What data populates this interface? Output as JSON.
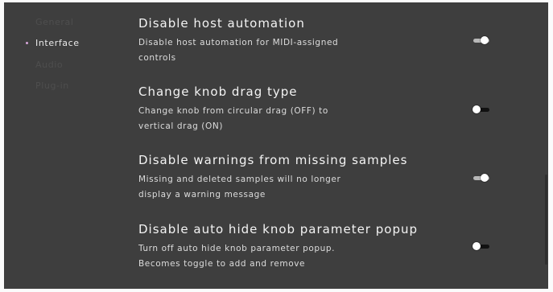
{
  "sidebar": {
    "items": [
      {
        "label": "General",
        "active": false
      },
      {
        "label": "Interface",
        "active": true
      },
      {
        "label": "Audio",
        "active": false
      },
      {
        "label": "Plug-in",
        "active": false
      }
    ]
  },
  "settings": [
    {
      "title": "Disable host automation",
      "description_line1": "Disable host automation for MIDI-assigned",
      "description_line2": "controls",
      "enabled": true
    },
    {
      "title": "Change knob drag type",
      "description_line1": "Change knob from circular drag (OFF) to",
      "description_line2": "vertical drag (ON)",
      "enabled": false
    },
    {
      "title": "Disable warnings from missing samples",
      "description_line1": "Missing and deleted samples will no longer",
      "description_line2": "display a warning message",
      "enabled": true
    },
    {
      "title": "Disable auto hide knob parameter popup",
      "description_line1": "Turn off auto hide knob parameter popup.",
      "description_line2": "Becomes toggle to add and remove",
      "enabled": false
    }
  ],
  "colors": {
    "background": "#3e3e3e",
    "accent": "#d7a6d9",
    "toggle_on_track": "#b8b8b8",
    "toggle_off_track": "#111111"
  }
}
